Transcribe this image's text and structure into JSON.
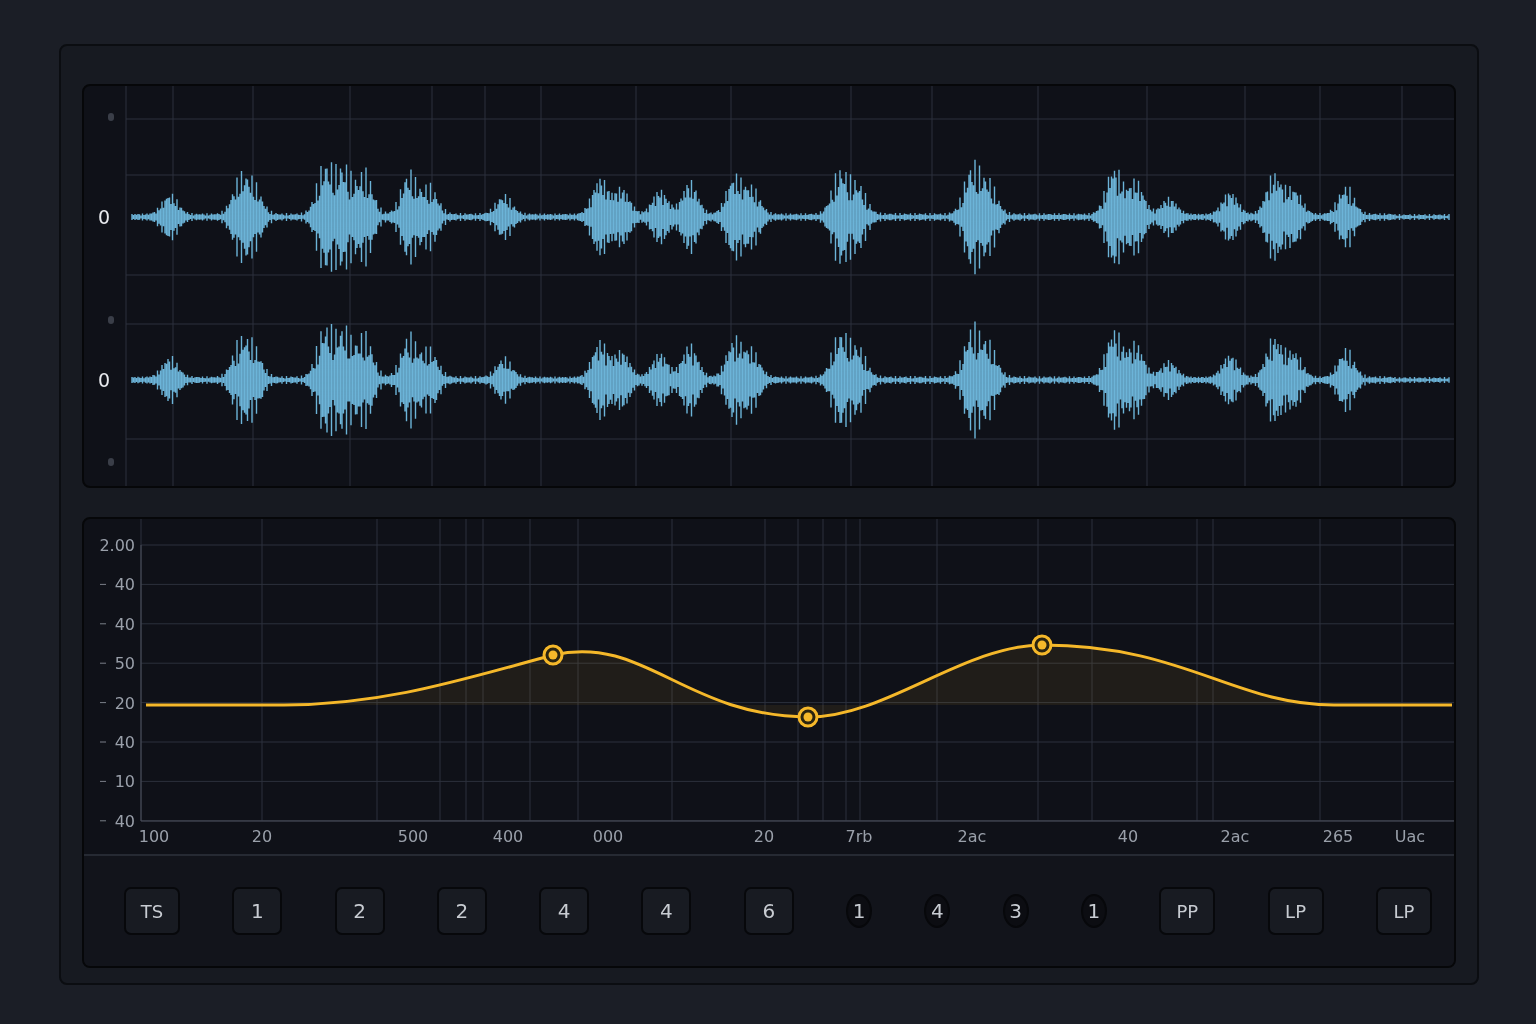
{
  "waveform": {
    "channels": [
      {
        "label": "0"
      },
      {
        "label": "0"
      }
    ]
  },
  "equalizer": {
    "y_labels": [
      "2.00",
      "40",
      "40",
      "50",
      "20",
      "40",
      "10",
      "40"
    ],
    "x_labels": [
      "100",
      "20",
      "500",
      "400",
      "000",
      "20",
      "7rb",
      "2ac",
      "40",
      "2ac",
      "265",
      "Uac"
    ]
  },
  "buttons": [
    {
      "label": "TS",
      "kind": "square"
    },
    {
      "label": "1",
      "kind": "square"
    },
    {
      "label": "2",
      "kind": "square"
    },
    {
      "label": "2",
      "kind": "square"
    },
    {
      "label": "4",
      "kind": "square"
    },
    {
      "label": "4",
      "kind": "square"
    },
    {
      "label": "6",
      "kind": "square"
    },
    {
      "label": "1",
      "kind": "round"
    },
    {
      "label": "4",
      "kind": "round"
    },
    {
      "label": "3",
      "kind": "round"
    },
    {
      "label": "1",
      "kind": "round"
    },
    {
      "label": "PP",
      "kind": "square"
    },
    {
      "label": "LP",
      "kind": "square"
    },
    {
      "label": "LP",
      "kind": "square"
    }
  ]
}
